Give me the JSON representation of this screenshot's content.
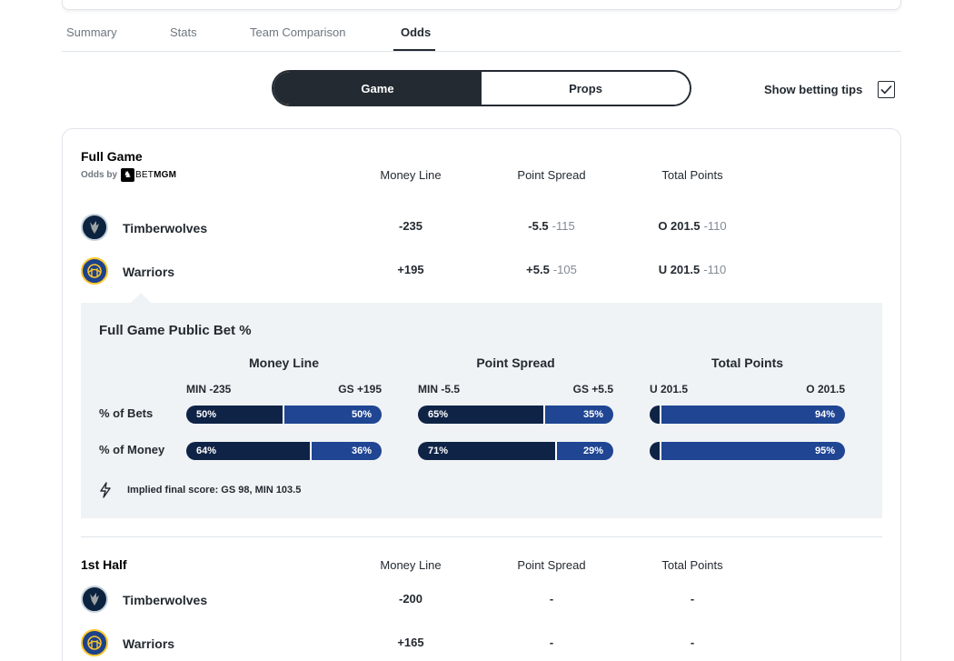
{
  "tabs": [
    {
      "label": "Summary"
    },
    {
      "label": "Stats"
    },
    {
      "label": "Team Comparison"
    },
    {
      "label": "Odds"
    }
  ],
  "segment": {
    "game": "Game",
    "props": "Props"
  },
  "betting_tips": {
    "label": "Show betting tips",
    "checked": true
  },
  "full_game": {
    "title": "Full Game",
    "odds_by": "Odds by",
    "sportsbook_bet": "BET",
    "sportsbook_mgm": "MGM",
    "columns": {
      "money_line": "Money Line",
      "point_spread": "Point Spread",
      "total_points": "Total Points"
    },
    "teams": [
      {
        "name": "Timberwolves",
        "money_line": "-235",
        "spread": "-5.5",
        "spread_juice": "-115",
        "total": "O 201.5",
        "total_juice": "-110"
      },
      {
        "name": "Warriors",
        "money_line": "+195",
        "spread": "+5.5",
        "spread_juice": "-105",
        "total": "U 201.5",
        "total_juice": "-110"
      }
    ]
  },
  "public_bet": {
    "title": "Full Game Public Bet %",
    "row_bets": "% of Bets",
    "row_money": "% of Money",
    "groups": [
      {
        "title": "Money Line",
        "left": "MIN -235",
        "right": "GS +195",
        "bets": [
          50,
          50
        ],
        "money": [
          64,
          36
        ],
        "bets_labels": [
          "50%",
          "50%"
        ],
        "money_labels": [
          "64%",
          "36%"
        ]
      },
      {
        "title": "Point Spread",
        "left": "MIN -5.5",
        "right": "GS +5.5",
        "bets": [
          65,
          35
        ],
        "money": [
          71,
          29
        ],
        "bets_labels": [
          "65%",
          "35%"
        ],
        "money_labels": [
          "71%",
          "29%"
        ]
      },
      {
        "title": "Total Points",
        "left": "U 201.5",
        "right": "O 201.5",
        "bets": [
          6,
          94
        ],
        "money": [
          5,
          95
        ],
        "bets_labels": [
          "6%",
          "94%"
        ],
        "money_labels": [
          "5%",
          "95%"
        ]
      }
    ],
    "implied": "Implied final score: GS 98, MIN 103.5"
  },
  "first_half": {
    "title": "1st Half",
    "columns": {
      "money_line": "Money Line",
      "point_spread": "Point Spread",
      "total_points": "Total Points"
    },
    "teams": [
      {
        "name": "Timberwolves",
        "money_line": "-200",
        "spread": "-",
        "total": "-"
      },
      {
        "name": "Warriors",
        "money_line": "+165",
        "spread": "-",
        "total": "-"
      }
    ]
  },
  "colors": {
    "dark": "#232a31",
    "bar_dark": "#0f2347",
    "bar_blue": "#1f4593",
    "panel": "#f0f3f5"
  }
}
